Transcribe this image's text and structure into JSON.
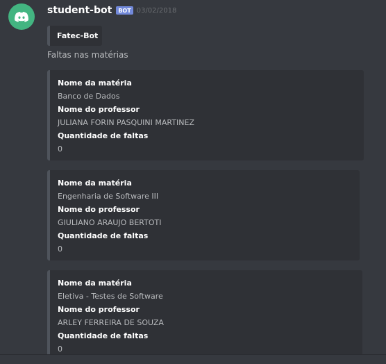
{
  "message": {
    "username": "student-bot",
    "bot_tag": "BOT",
    "timestamp": "03/02/2018",
    "title_embed": "Fatec-Bot",
    "content": "Faltas nas matérias"
  },
  "embeds": [
    {
      "field1_name": "Nome da matéria",
      "field1_value": "Banco de Dados",
      "field2_name": "Nome do professor",
      "field2_value": "JULIANA FORIN PASQUINI MARTINEZ",
      "field3_name": "Quantidade de faltas",
      "field3_value": "0"
    },
    {
      "field1_name": "Nome da matéria",
      "field1_value": "Engenharia de Software III",
      "field2_name": "Nome do professor",
      "field2_value": "GIULIANO ARAUJO BERTOTI",
      "field3_name": "Quantidade de faltas",
      "field3_value": "0"
    },
    {
      "field1_name": "Nome da matéria",
      "field1_value": "Eletiva - Testes de Software",
      "field2_name": "Nome do professor",
      "field2_value": "ARLEY FERREIRA DE SOUZA",
      "field3_name": "Quantidade de faltas",
      "field3_value": "0"
    }
  ],
  "icons": {
    "avatar": "discord-logo-icon"
  },
  "colors": {
    "background": "#36393f",
    "embed_background": "#2f3136",
    "avatar": "#43b581",
    "bot_tag": "#7289da"
  }
}
